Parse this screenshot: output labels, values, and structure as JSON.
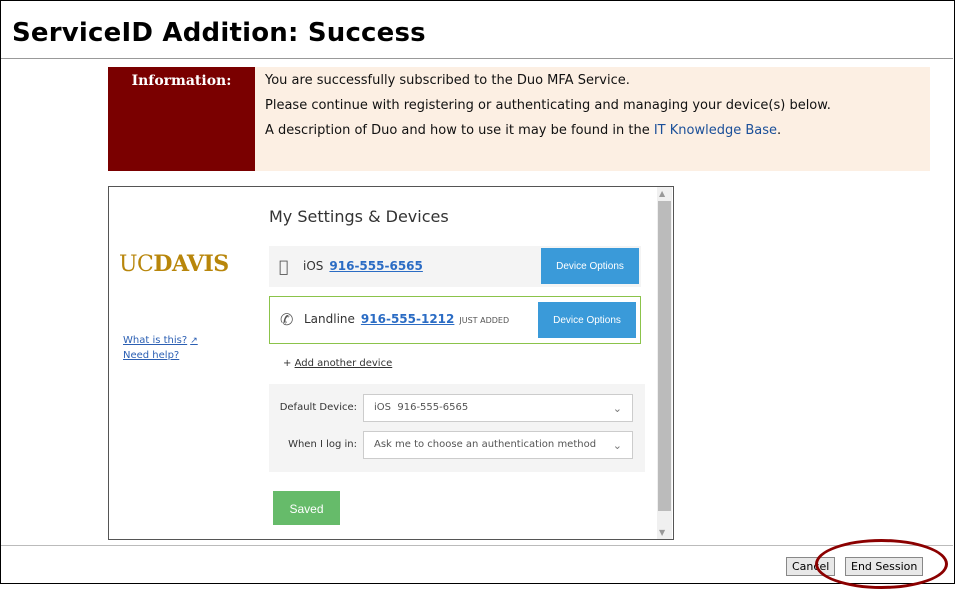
{
  "page": {
    "title": "ServiceID Addition: Success"
  },
  "info": {
    "label": "Information:",
    "line1": "You are successfully subscribed to the Duo MFA Service.",
    "line2": "Please continue with registering or authenticating and managing your device(s) below.",
    "line3_prefix": "A description of Duo and how to use it may be found in the ",
    "line3_link": "IT Knowledge Base",
    "line3_suffix": "."
  },
  "duo": {
    "logo_uc": "UC",
    "logo_davis": "DAVIS",
    "what_is_this": "What is this?",
    "need_help": "Need help?",
    "settings_title": "My Settings & Devices",
    "devices": [
      {
        "icon": "apple-icon",
        "name": "iOS",
        "number": "916-555-6565",
        "badge": "",
        "button": "Device Options"
      },
      {
        "icon": "phone-icon",
        "name": "Landline",
        "number": "916-555-1212",
        "badge": "JUST ADDED",
        "button": "Device Options"
      }
    ],
    "add_device": "Add another device",
    "default_device_label": "Default Device:",
    "default_device_value_prefix": "iOS",
    "default_device_value_number": "916-555-6565",
    "when_login_label": "When I log in:",
    "when_login_value": "Ask me to choose an authentication method",
    "saved_label": "Saved"
  },
  "footer": {
    "cancel_label": "Cancel",
    "end_session_label": "End Session"
  },
  "colors": {
    "maroon": "#7a0000",
    "duo_blue": "#3a9ad9",
    "saved_green": "#66bb6a",
    "gold": "#b8860b"
  }
}
